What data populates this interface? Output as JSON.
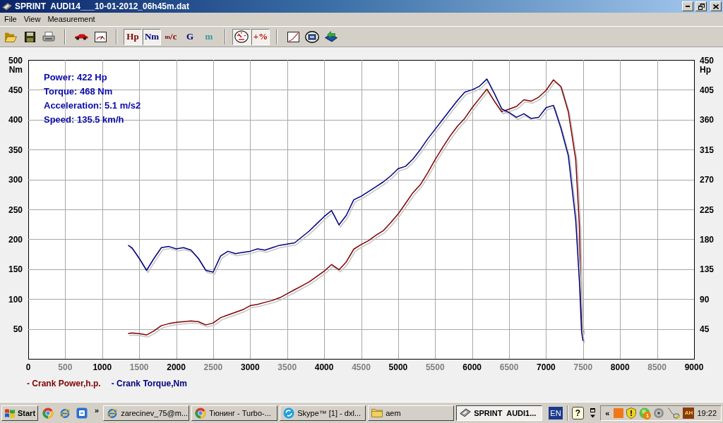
{
  "window": {
    "title": "SPRINT  AUDI14___10-01-2012_06h45m.dat"
  },
  "menu": [
    "File",
    "View",
    "Measurement"
  ],
  "toolbar": {
    "groups": [
      [
        {
          "kind": "icon",
          "pressed": false
        },
        {
          "kind": "icon",
          "pressed": false
        },
        {
          "kind": "icon",
          "pressed": false
        }
      ],
      [
        {
          "kind": "icon",
          "pressed": false
        },
        {
          "kind": "icon",
          "pressed": false
        }
      ],
      [
        {
          "kind": "text",
          "label": "Hp",
          "color": "#800000",
          "pressed": true
        },
        {
          "kind": "text",
          "label": "Nm",
          "color": "#000080",
          "pressed": true
        },
        {
          "kind": "text",
          "label": "$^{m}$/c",
          "color": "#800000",
          "pressed": false
        },
        {
          "kind": "text",
          "label": "G",
          "color": "#000080",
          "pressed": false
        },
        {
          "kind": "text",
          "label": "m",
          "color": "#339999",
          "pressed": false
        }
      ],
      [
        {
          "kind": "icon",
          "pressed": true
        },
        {
          "kind": "text",
          "label": "+%",
          "color": "#c00000",
          "pressed": true
        }
      ],
      [
        {
          "kind": "icon",
          "pressed": false
        },
        {
          "kind": "icon",
          "pressed": false
        },
        {
          "kind": "icon",
          "pressed": false
        }
      ]
    ]
  },
  "readout": [
    "Power: 422 Hp",
    "Torque: 468 Nm",
    "Acceleration: 5.1 m/s2",
    "Speed: 135.5 km/h"
  ],
  "chart_data": {
    "type": "line",
    "grid": true,
    "x": [
      1350,
      1400,
      1500,
      1600,
      1700,
      1800,
      1900,
      2000,
      2100,
      2200,
      2300,
      2400,
      2500,
      2600,
      2700,
      2800,
      2900,
      3000,
      3100,
      3200,
      3300,
      3400,
      3500,
      3600,
      3700,
      3800,
      3900,
      4000,
      4100,
      4200,
      4300,
      4400,
      4500,
      4600,
      4700,
      4800,
      4900,
      5000,
      5100,
      5200,
      5300,
      5400,
      5500,
      5600,
      5700,
      5800,
      5900,
      6000,
      6100,
      6200,
      6300,
      6400,
      6500,
      6600,
      6700,
      6800,
      6900,
      7000,
      7100,
      7200,
      7300,
      7400,
      7450,
      7480,
      7500
    ],
    "xlim": [
      0,
      9000
    ],
    "ylim": [
      0,
      500
    ],
    "y2lim": [
      0,
      450
    ],
    "xticks": [
      0,
      500,
      1000,
      1500,
      2000,
      2500,
      3000,
      3500,
      4000,
      4500,
      5000,
      5500,
      6000,
      6500,
      7000,
      7500,
      8000,
      8500,
      9000
    ],
    "yticks": [
      50,
      100,
      150,
      200,
      250,
      300,
      350,
      400,
      450,
      500
    ],
    "y2ticks": [
      45,
      90,
      135,
      180,
      225,
      270,
      315,
      360,
      405,
      450
    ],
    "ylabel": "Nm",
    "y2label": "Hp",
    "series": [
      {
        "name": "- Crank Power,h.p.",
        "color": "#800000",
        "axis": "y2",
        "values": [
          38,
          39,
          38,
          36,
          42,
          50,
          53,
          55,
          56,
          57,
          56,
          51,
          54,
          62,
          66,
          70,
          74,
          80,
          82,
          85,
          88,
          92,
          98,
          104,
          110,
          116,
          124,
          132,
          142,
          134,
          146,
          165,
          172,
          178,
          186,
          193,
          205,
          218,
          234,
          250,
          262,
          280,
          300,
          318,
          335,
          350,
          362,
          378,
          392,
          406,
          388,
          372,
          376,
          380,
          390,
          388,
          394,
          404,
          420,
          410,
          372,
          300,
          200,
          60,
          40
        ]
      },
      {
        "name": "- Crank Torque,Nm",
        "color": "#000080",
        "values": [
          190,
          186,
          168,
          148,
          168,
          186,
          188,
          184,
          186,
          182,
          168,
          148,
          145,
          172,
          180,
          176,
          178,
          180,
          184,
          182,
          186,
          190,
          192,
          194,
          204,
          214,
          226,
          238,
          248,
          224,
          240,
          266,
          272,
          280,
          288,
          296,
          306,
          318,
          322,
          334,
          350,
          368,
          384,
          400,
          416,
          432,
          446,
          450,
          456,
          468,
          444,
          418,
          412,
          404,
          410,
          402,
          404,
          420,
          424,
          386,
          340,
          232,
          130,
          45,
          30
        ]
      }
    ]
  },
  "taskbar": {
    "start": "Start",
    "quick_launch_more": "»",
    "tasks": [
      {
        "label": "zarecinev_75@m...",
        "selected": false
      },
      {
        "label": "Тюнинг - Turbo-...",
        "selected": false
      },
      {
        "label": "Skype™ [1] - dxl...",
        "selected": false
      },
      {
        "label": "aem",
        "selected": false
      },
      {
        "label": "SPRINT  AUDI1...",
        "selected": true
      }
    ],
    "language": "EN",
    "help": "?",
    "tray": {
      "expand": "«",
      "badge": "1",
      "tile": "AH",
      "clock": "19:22"
    }
  }
}
